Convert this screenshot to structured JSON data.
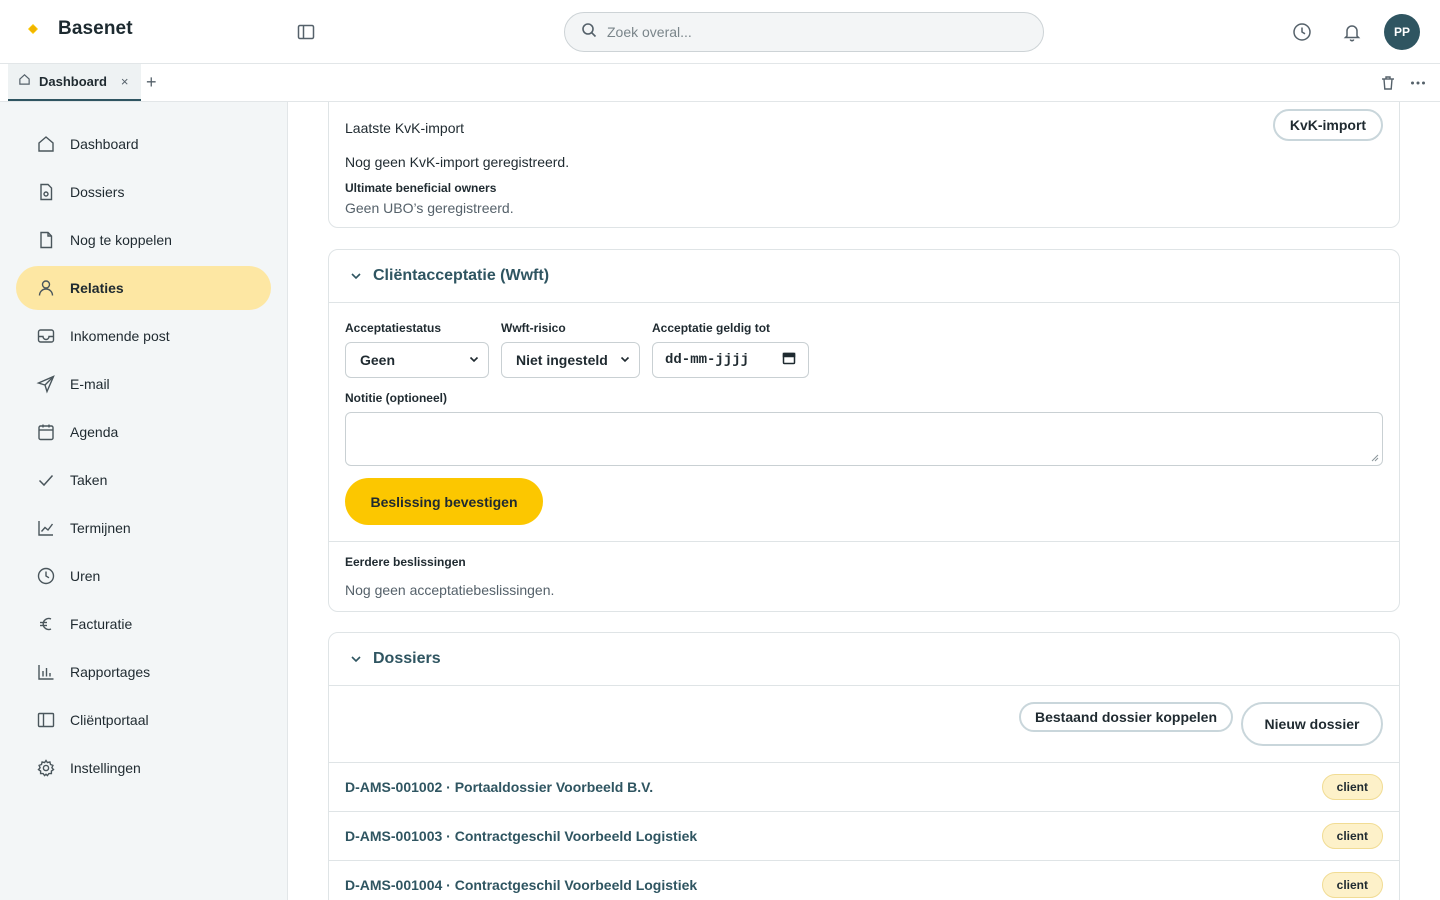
{
  "app": {
    "name": "Basenet"
  },
  "search": {
    "placeholder": "Zoek overal..."
  },
  "user": {
    "initials": "PP"
  },
  "tabs": [
    {
      "label": "Dashboard",
      "close": "×"
    }
  ],
  "tab_add": "+",
  "sidebar": {
    "items": [
      {
        "label": "Dashboard",
        "icon": "home-icon"
      },
      {
        "label": "Dossiers",
        "icon": "file-icon"
      },
      {
        "label": "Nog te koppelen",
        "icon": "document-icon"
      },
      {
        "label": "Relaties",
        "icon": "user-icon",
        "active": true
      },
      {
        "label": "Inkomende post",
        "icon": "inbox-icon"
      },
      {
        "label": "E-mail",
        "icon": "send-icon"
      },
      {
        "label": "Agenda",
        "icon": "calendar-icon"
      },
      {
        "label": "Taken",
        "icon": "check-icon"
      },
      {
        "label": "Termijnen",
        "icon": "chart-line-icon"
      },
      {
        "label": "Uren",
        "icon": "clock-icon"
      },
      {
        "label": "Facturatie",
        "icon": "euro-icon"
      },
      {
        "label": "Rapportages",
        "icon": "bar-chart-icon"
      },
      {
        "label": "Cliëntportaal",
        "icon": "portal-icon"
      },
      {
        "label": "Instellingen",
        "icon": "gear-icon"
      }
    ]
  },
  "kvk": {
    "title": "Laatste KvK-import",
    "button": "KvK-import",
    "empty": "Nog geen KvK-import geregistreerd.",
    "ubo_label": "Ultimate beneficial owners",
    "ubo_text": "Geen UBO’s geregistreerd."
  },
  "acceptance": {
    "title": "Cliëntacceptatie (Wwft)",
    "status_label": "Acceptatiestatus",
    "status_value": "Geen",
    "risk_label": "Wwft-risico",
    "risk_value": "Niet ingesteld",
    "valid_label": "Acceptatie geldig tot",
    "valid_placeholder": "dd-mm-jjjj",
    "note_label": "Notitie (optioneel)",
    "confirm_button": "Beslissing bevestigen",
    "previous_label": "Eerdere beslissingen",
    "previous_empty": "Nog geen acceptatiebeslissingen."
  },
  "dossiers": {
    "title": "Dossiers",
    "link_button": "Bestaand dossier koppelen",
    "new_button": "Nieuw dossier",
    "rows": [
      {
        "title": "D-AMS-001002 · Portaaldossier Voorbeeld B.V.",
        "badge": "client"
      },
      {
        "title": "D-AMS-001003 · Contractgeschil Voorbeeld Logistiek",
        "badge": "client"
      },
      {
        "title": "D-AMS-001004 · Contractgeschil Voorbeeld Logistiek",
        "badge": "client"
      }
    ]
  },
  "colors": {
    "accent": "#fcc700",
    "brand_dark": "#2f5561",
    "active_nav": "#fde7a3"
  }
}
